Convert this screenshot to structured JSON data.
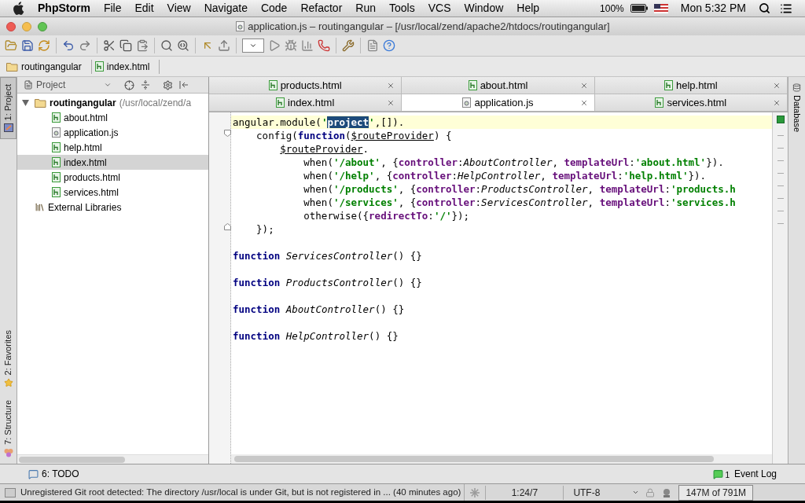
{
  "menu_bar": {
    "app": "PhpStorm",
    "items": [
      "File",
      "Edit",
      "View",
      "Navigate",
      "Code",
      "Refactor",
      "Run",
      "Tools",
      "VCS",
      "Window",
      "Help"
    ],
    "battery": "100%",
    "clock": "Mon 5:32 PM"
  },
  "window": {
    "title": "application.js – routingangular – [/usr/local/zend/apache2/htdocs/routingangular]"
  },
  "breadcrumbs": [
    {
      "label": "routingangular",
      "kind": "folder"
    },
    {
      "label": "index.html",
      "kind": "html"
    }
  ],
  "side_tabs": [
    {
      "label": "1: Project",
      "selected": true
    },
    {
      "label": "2: Favorites",
      "selected": false
    },
    {
      "label": "7: Structure",
      "selected": false
    }
  ],
  "project": {
    "title": "Project",
    "tree": [
      {
        "label": "routingangular",
        "path": "(/usr/local/zend/a",
        "kind": "folder",
        "expanded": true,
        "selected": false,
        "children": [
          {
            "label": "about.html",
            "kind": "html",
            "selected": false
          },
          {
            "label": "application.js",
            "kind": "js",
            "selected": false
          },
          {
            "label": "help.html",
            "kind": "html",
            "selected": false
          },
          {
            "label": "index.html",
            "kind": "html",
            "selected": true
          },
          {
            "label": "products.html",
            "kind": "html",
            "selected": false
          },
          {
            "label": "services.html",
            "kind": "html",
            "selected": false
          }
        ]
      },
      {
        "label": "External Libraries",
        "kind": "library",
        "selected": false
      }
    ]
  },
  "tab_rows": [
    [
      {
        "label": "products.html",
        "kind": "html",
        "selected": false
      },
      {
        "label": "about.html",
        "kind": "html",
        "selected": false
      },
      {
        "label": "help.html",
        "kind": "html",
        "selected": false
      }
    ],
    [
      {
        "label": "index.html",
        "kind": "html",
        "selected": false
      },
      {
        "label": "application.js",
        "kind": "js",
        "selected": true
      },
      {
        "label": "services.html",
        "kind": "html",
        "selected": false
      }
    ]
  ],
  "right_tabs": [
    {
      "label": "Database"
    }
  ],
  "code": [
    {
      "current": true,
      "tokens": [
        {
          "text": "angular.module(",
          "kind": "plain"
        },
        {
          "text": "'",
          "kind": "string"
        },
        {
          "text": "project",
          "kind": "selected"
        },
        {
          "text": "'",
          "kind": "string"
        },
        {
          "text": ",[]).",
          "kind": "plain"
        }
      ],
      "children": [
        {
          "current": false,
          "tokens": [
            {
              "text": "config(",
              "kind": "plain"
            },
            {
              "text": "function",
              "kind": "keyword"
            },
            {
              "text": "(",
              "kind": "plain"
            },
            {
              "text": "$routeProvider",
              "kind": "param"
            },
            {
              "text": ") {",
              "kind": "plain"
            }
          ],
          "children": [
            {
              "current": false,
              "tokens": [
                {
                  "text": "$routeProvider",
                  "kind": "param"
                },
                {
                  "text": ".",
                  "kind": "plain"
                }
              ],
              "children": [
                {
                  "current": false,
                  "tokens": [
                    {
                      "text": "when(",
                      "kind": "plain"
                    },
                    {
                      "text": "'/about'",
                      "kind": "string"
                    },
                    {
                      "text": ", {",
                      "kind": "plain"
                    },
                    {
                      "text": "controller",
                      "kind": "prop"
                    },
                    {
                      "text": ":",
                      "kind": "plain"
                    },
                    {
                      "text": "AboutController",
                      "kind": "italic"
                    },
                    {
                      "text": ", ",
                      "kind": "plain"
                    },
                    {
                      "text": "templateUrl",
                      "kind": "prop"
                    },
                    {
                      "text": ":",
                      "kind": "plain"
                    },
                    {
                      "text": "'about.html'",
                      "kind": "string"
                    },
                    {
                      "text": "}).",
                      "kind": "plain"
                    }
                  ]
                },
                {
                  "current": false,
                  "tokens": [
                    {
                      "text": "when(",
                      "kind": "plain"
                    },
                    {
                      "text": "'/help'",
                      "kind": "string"
                    },
                    {
                      "text": ", {",
                      "kind": "plain"
                    },
                    {
                      "text": "controller",
                      "kind": "prop"
                    },
                    {
                      "text": ":",
                      "kind": "plain"
                    },
                    {
                      "text": "HelpController",
                      "kind": "italic"
                    },
                    {
                      "text": ", ",
                      "kind": "plain"
                    },
                    {
                      "text": "templateUrl",
                      "kind": "prop"
                    },
                    {
                      "text": ":",
                      "kind": "plain"
                    },
                    {
                      "text": "'help.html'",
                      "kind": "string"
                    },
                    {
                      "text": "}).",
                      "kind": "plain"
                    }
                  ]
                },
                {
                  "current": false,
                  "tokens": [
                    {
                      "text": "when(",
                      "kind": "plain"
                    },
                    {
                      "text": "'/products'",
                      "kind": "string"
                    },
                    {
                      "text": ", {",
                      "kind": "plain"
                    },
                    {
                      "text": "controller",
                      "kind": "prop"
                    },
                    {
                      "text": ":",
                      "kind": "plain"
                    },
                    {
                      "text": "ProductsController",
                      "kind": "italic"
                    },
                    {
                      "text": ", ",
                      "kind": "plain"
                    },
                    {
                      "text": "templateUrl",
                      "kind": "prop"
                    },
                    {
                      "text": ":",
                      "kind": "plain"
                    },
                    {
                      "text": "'products.h",
                      "kind": "string"
                    }
                  ]
                },
                {
                  "current": false,
                  "tokens": [
                    {
                      "text": "when(",
                      "kind": "plain"
                    },
                    {
                      "text": "'/services'",
                      "kind": "string"
                    },
                    {
                      "text": ", {",
                      "kind": "plain"
                    },
                    {
                      "text": "controller",
                      "kind": "prop"
                    },
                    {
                      "text": ":",
                      "kind": "plain"
                    },
                    {
                      "text": "ServicesController",
                      "kind": "italic"
                    },
                    {
                      "text": ", ",
                      "kind": "plain"
                    },
                    {
                      "text": "templateUrl",
                      "kind": "prop"
                    },
                    {
                      "text": ":",
                      "kind": "plain"
                    },
                    {
                      "text": "'services.h",
                      "kind": "string"
                    }
                  ]
                },
                {
                  "current": false,
                  "tokens": [
                    {
                      "text": "otherwise({",
                      "kind": "plain"
                    },
                    {
                      "text": "redirectTo",
                      "kind": "prop"
                    },
                    {
                      "text": ":",
                      "kind": "plain"
                    },
                    {
                      "text": "'/'",
                      "kind": "string"
                    },
                    {
                      "text": "});",
                      "kind": "plain"
                    }
                  ]
                }
              ]
            }
          ]
        },
        {
          "current": false,
          "tokens": [
            {
              "text": "});",
              "kind": "plain"
            }
          ]
        }
      ]
    }
  ],
  "declarations": [
    {
      "keyword": "function",
      "name": "ServicesController",
      "rest": "() {}"
    },
    {
      "keyword": "function",
      "name": "ProductsController",
      "rest": "() {}"
    },
    {
      "keyword": "function",
      "name": "AboutController",
      "rest": "() {}"
    },
    {
      "keyword": "function",
      "name": "HelpController",
      "rest": "() {}"
    }
  ],
  "tool_bar": {
    "todo": "6: TODO",
    "event_count": "1",
    "event_log": "Event Log"
  },
  "status_bar": {
    "message": "Unregistered Git root detected: The directory /usr/local is under Git, but is not registered in ... (40 minutes ago)",
    "position": "1:24/7",
    "encoding": "UTF-8",
    "memory": "147M of 791M"
  }
}
